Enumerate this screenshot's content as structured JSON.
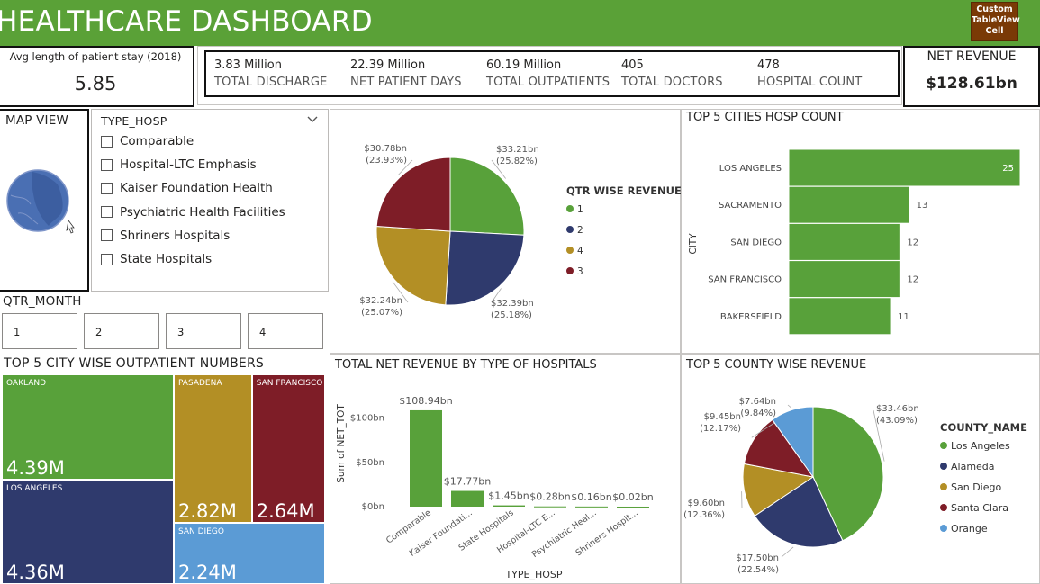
{
  "header": {
    "title": "HEALTHCARE DASHBOARD",
    "custom_button": [
      "Custom",
      "TableView",
      "Cell"
    ]
  },
  "colors": {
    "header": "#5aa137",
    "green": "#58a13a",
    "navy": "#2f3a6d",
    "gold": "#b38f25",
    "maroon": "#7e1d27",
    "blue": "#5b9bd5",
    "button": "#7a3a06"
  },
  "avg_stay": {
    "label": "Avg length of patient stay (2018)",
    "value": "5.85"
  },
  "kpis": [
    {
      "value": "3.83 Million",
      "label": "TOTAL DISCHARGE"
    },
    {
      "value": "22.39 Million",
      "label": "NET PATIENT DAYS"
    },
    {
      "value": "60.19 Million",
      "label": "TOTAL OUTPATIENTS"
    },
    {
      "value": "405",
      "label": "TOTAL DOCTORS"
    },
    {
      "value": "478",
      "label": "HOSPITAL COUNT"
    }
  ],
  "net_revenue": {
    "label": "NET REVENUE",
    "value": "$128.61bn"
  },
  "map": {
    "title": "MAP VIEW",
    "icon": "globe-icon"
  },
  "type_hosp_slicer": {
    "title": "TYPE_HOSP",
    "items": [
      "Comparable",
      "Hospital-LTC Emphasis",
      "Kaiser Foundation Health",
      "Psychiatric Health Facilities",
      "Shriners Hospitals",
      "State Hospitals"
    ]
  },
  "qtr_month": {
    "title": "QTR_MONTH",
    "items": [
      "1",
      "2",
      "3",
      "4"
    ]
  },
  "chart_data": [
    {
      "type": "pie",
      "title": "",
      "legend_title": "QTR WISE REVENUE",
      "legend_position": "right",
      "slices": [
        {
          "name": "1",
          "value": 33.21,
          "label": "$33.21bn",
          "pct": "(25.82%)",
          "color": "#58a13a"
        },
        {
          "name": "2",
          "value": 32.39,
          "label": "$32.39bn",
          "pct": "(25.18%)",
          "color": "#2f3a6d"
        },
        {
          "name": "4",
          "value": 32.24,
          "label": "$32.24bn",
          "pct": "(25.07%)",
          "color": "#b38f25"
        },
        {
          "name": "3",
          "value": 30.78,
          "label": "$30.78bn",
          "pct": "(23.93%)",
          "color": "#7e1d27"
        }
      ]
    },
    {
      "type": "bar",
      "orientation": "horizontal",
      "title": "TOP 5 CITIES HOSP COUNT",
      "ylabel": "CITY",
      "categories": [
        "LOS ANGELES",
        "SACRAMENTO",
        "SAN DIEGO",
        "SAN FRANCISCO",
        "BAKERSFIELD"
      ],
      "values": [
        25,
        13,
        12,
        12,
        11
      ],
      "xlim": [
        0,
        25
      ]
    },
    {
      "type": "treemap",
      "title": "TOP 5 CITY WISE OUTPATIENT NUMBERS",
      "items": [
        {
          "name": "OAKLAND",
          "value": 4.39,
          "label": "4.39M",
          "color": "#58a13a"
        },
        {
          "name": "LOS ANGELES",
          "value": 4.36,
          "label": "4.36M",
          "color": "#2f3a6d"
        },
        {
          "name": "PASADENA",
          "value": 2.82,
          "label": "2.82M",
          "color": "#b38f25"
        },
        {
          "name": "SAN FRANCISCO",
          "value": 2.64,
          "label": "2.64M",
          "color": "#7e1d27"
        },
        {
          "name": "SAN DIEGO",
          "value": 2.24,
          "label": "2.24M",
          "color": "#5b9bd5"
        }
      ]
    },
    {
      "type": "bar",
      "title": "TOTAL NET REVENUE BY TYPE OF HOSPITALS",
      "xlabel": "TYPE_HOSP",
      "ylabel": "Sum of NET_TOT",
      "categories": [
        "Comparable",
        "Kaiser Foundati...",
        "State Hospitals",
        "Hospital-LTC E...",
        "Psychiatric Heal...",
        "Shriners Hospit..."
      ],
      "values": [
        108.94,
        17.77,
        1.45,
        0.28,
        0.16,
        0.02
      ],
      "data_labels": [
        "$108.94bn",
        "$17.77bn",
        "$1.45bn",
        "$0.28bn",
        "$0.16bn",
        "$0.02bn"
      ],
      "yticks": [
        {
          "value": 0,
          "label": "$0bn"
        },
        {
          "value": 50,
          "label": "$50bn"
        },
        {
          "value": 100,
          "label": "$100bn"
        }
      ],
      "ylim": [
        0,
        115
      ]
    },
    {
      "type": "pie",
      "title": "TOP 5 COUNTY WISE REVENUE",
      "legend_title": "COUNTY_NAME",
      "legend_position": "right",
      "slices": [
        {
          "name": "Los Angeles",
          "value": 33.46,
          "label": "$33.46bn",
          "pct": "(43.09%)",
          "color": "#58a13a"
        },
        {
          "name": "Alameda",
          "value": 17.5,
          "label": "$17.50bn",
          "pct": "(22.54%)",
          "color": "#2f3a6d"
        },
        {
          "name": "San Diego",
          "value": 9.6,
          "label": "$9.60bn",
          "pct": "(12.36%)",
          "color": "#b38f25"
        },
        {
          "name": "Santa Clara",
          "value": 9.45,
          "label": "$9.45bn",
          "pct": "(12.17%)",
          "color": "#7e1d27"
        },
        {
          "name": "Orange",
          "value": 7.64,
          "label": "$7.64bn",
          "pct": "(9.84%)",
          "color": "#5b9bd5"
        }
      ]
    }
  ]
}
